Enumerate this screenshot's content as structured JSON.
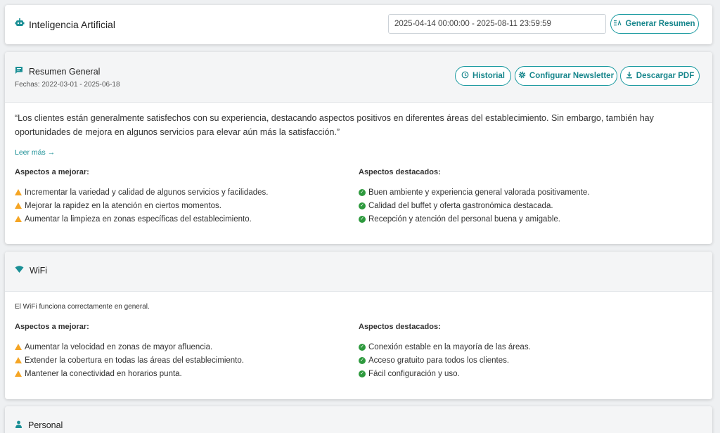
{
  "header": {
    "title": "Inteligencia Artificial",
    "date_range": "2025-04-14 00:00:00 - 2025-08-11 23:59:59",
    "generate_label": "Generar Resumen"
  },
  "summary": {
    "title": "Resumen General",
    "dates": "Fechas: 2022-03-01 - 2025-06-18",
    "history_label": "Historial",
    "newsletter_label": "Configurar Newsletter",
    "pdf_label": "Descargar PDF",
    "quote": "“Los clientes están generalmente satisfechos con su experiencia, destacando aspectos positivos en diferentes áreas del establecimiento. Sin embargo, también hay oportunidades de mejora en algunos servicios para elevar aún más la satisfacción.”",
    "read_more": "Leer más",
    "improve_title": "Aspectos a mejorar:",
    "improve": [
      "Incrementar la variedad y calidad de algunos servicios y facilidades.",
      "Mejorar la rapidez en la atención en ciertos momentos.",
      "Aumentar la limpieza en zonas específicas del establecimiento."
    ],
    "highlight_title": "Aspectos destacados:",
    "highlights": [
      "Buen ambiente y experiencia general valorada positivamente.",
      "Calidad del buffet y oferta gastronómica destacada.",
      "Recepción y atención del personal buena y amigable."
    ]
  },
  "wifi": {
    "title": "WiFi",
    "description": "El WiFi funciona correctamente en general.",
    "improve_title": "Aspectos a mejorar:",
    "improve": [
      "Aumentar la velocidad en zonas de mayor afluencia.",
      "Extender la cobertura en todas las áreas del establecimiento.",
      "Mantener la conectividad en horarios punta."
    ],
    "highlight_title": "Aspectos destacados:",
    "highlights": [
      "Conexión estable en la mayoría de las áreas.",
      "Acceso gratuito para todos los clientes.",
      "Fácil configuración y uso."
    ]
  },
  "personal": {
    "title": "Personal"
  },
  "colors": {
    "accent": "#1a9aa0",
    "warning": "#f5a524",
    "success": "#2e9a3e"
  },
  "icons": {
    "header": "robot-icon",
    "generate": "sort-icon",
    "summary": "chat-icon",
    "history": "history-icon",
    "newsletter": "gear-icon",
    "pdf": "download-icon",
    "wifi": "wifi-icon",
    "personal": "person-icon",
    "read_more": "arrow-right-icon"
  }
}
